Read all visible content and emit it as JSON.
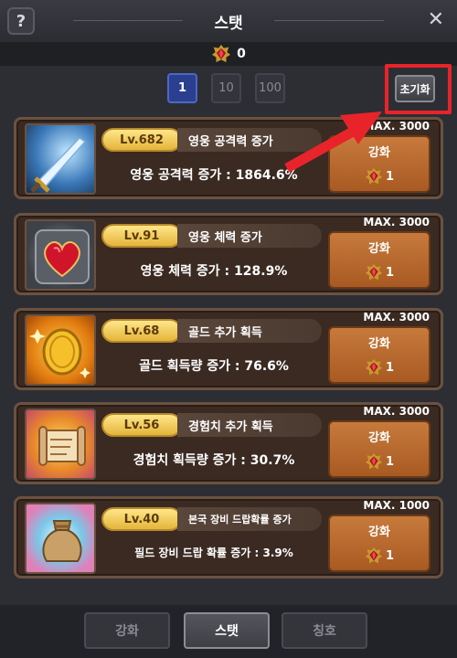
{
  "header": {
    "title": "스탯",
    "help": "?",
    "close": "✕"
  },
  "currency": {
    "icon": "ruby-gem-icon",
    "value": "0"
  },
  "multipliers": [
    {
      "label": "1",
      "active": true
    },
    {
      "label": "10",
      "active": false
    },
    {
      "label": "100",
      "active": false
    }
  ],
  "reset_label": "초기화",
  "stats": [
    {
      "level": "Lv.682",
      "name": "영웅 공격력 증가",
      "effect": "영웅 공격력 증가 : 1864.6%",
      "max": "MAX. 3000",
      "upgrade": "강화",
      "cost": "1",
      "icon": "sword-icon"
    },
    {
      "level": "Lv.91",
      "name": "영웅 체력 증가",
      "effect": "영웅 체력 증가 : 128.9%",
      "max": "MAX. 3000",
      "upgrade": "강화",
      "cost": "1",
      "icon": "heart-icon"
    },
    {
      "level": "Lv.68",
      "name": "골드 추가 획득",
      "effect": "골드 획득량 증가 : 76.6%",
      "max": "MAX. 3000",
      "upgrade": "강화",
      "cost": "1",
      "icon": "gold-coin-icon"
    },
    {
      "level": "Lv.56",
      "name": "경험치 추가 획득",
      "effect": "경험치 획득량 증가 : 30.7%",
      "max": "MAX. 3000",
      "upgrade": "강화",
      "cost": "1",
      "icon": "scroll-icon"
    },
    {
      "level": "Lv.40",
      "name": "본국 장비 드랍확률 증가",
      "effect": "필드 장비 드랍 확률 증가 : 3.9%",
      "max": "MAX. 1000",
      "upgrade": "강화",
      "cost": "1",
      "icon": "loot-bag-icon"
    }
  ],
  "tabs": [
    {
      "label": "강화",
      "active": false
    },
    {
      "label": "스탯",
      "active": true
    },
    {
      "label": "칭호",
      "active": false
    }
  ]
}
